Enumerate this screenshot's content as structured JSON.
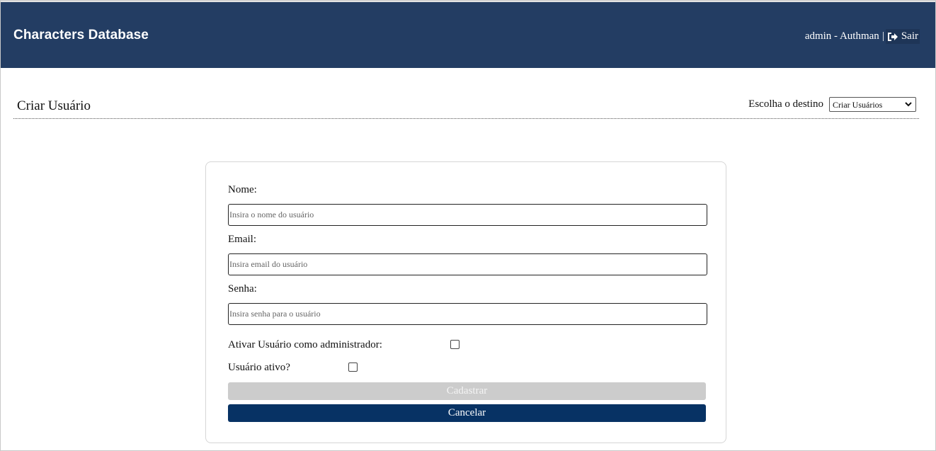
{
  "header": {
    "app_title": "Characters Database",
    "user_label": "admin - Authman",
    "separator": "|",
    "logout_label": "Sair",
    "logout_icon": "sign-out-icon",
    "bg_color": "#233d63"
  },
  "page": {
    "title": "Criar Usuário",
    "destination_label": "Escolha o destino",
    "destination_selected": "Criar Usuários"
  },
  "form": {
    "name_label": "Nome:",
    "name_placeholder": "Insira o nome do usuário",
    "email_label": "Email:",
    "email_placeholder": "Insira email do usuário",
    "password_label": "Senha:",
    "password_placeholder": "Insira senha para o usuário",
    "admin_label": "Ativar Usuário como administrador:",
    "active_label": "Usuário ativo?",
    "submit_label": "Cadastrar",
    "cancel_label": "Cancelar",
    "submit_color": "#cccccc",
    "cancel_color": "#073264"
  }
}
